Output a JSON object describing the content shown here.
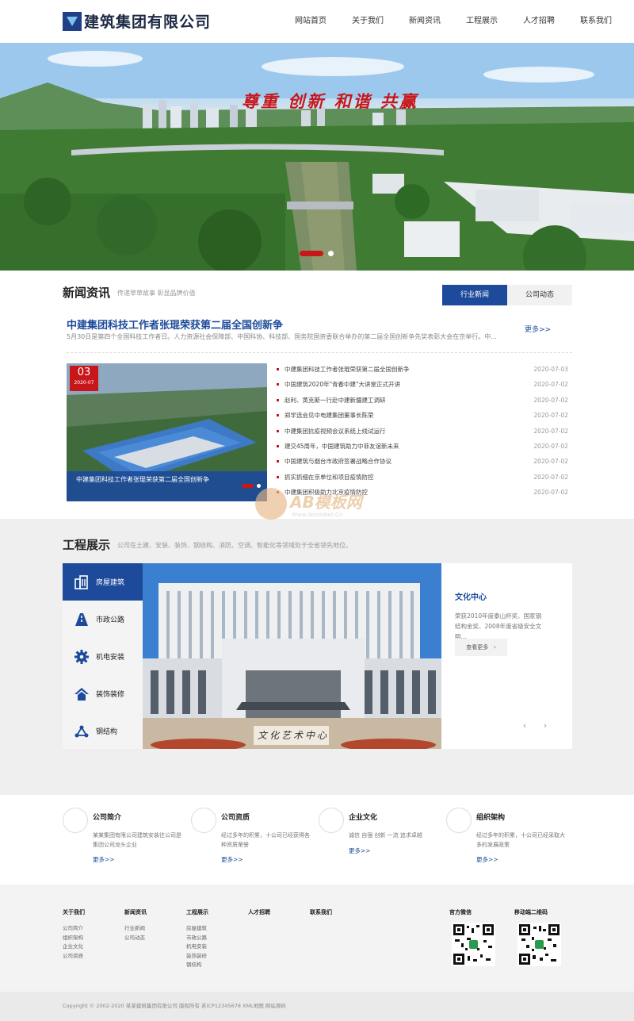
{
  "header": {
    "logo_text": "建筑集团有限公司",
    "nav": [
      "网站首页",
      "关于我们",
      "新闻资讯",
      "工程展示",
      "人才招聘",
      "联系我们"
    ]
  },
  "banner": {
    "slogan": "尊重 创新 和谐 共赢",
    "slide_index": 1,
    "slide_count": 2
  },
  "news": {
    "title": "新闻资讯",
    "subtitle": "传递草草故事 彰显品牌价值",
    "tabs": [
      "行业新闻",
      "公司动态"
    ],
    "active_tab": "行业新闻",
    "headline": "中建集团科技工作者张琨荣获第二届全国创新争",
    "headline_desc": "5月30日是第四个全国科技工作者日。人力资源社会保障部、中国科协、科技部、国务院国资委联合举办的第二届全国创新争先奖表彰大会在京举行。中...",
    "more": "更多>>",
    "featured": {
      "day": "03",
      "ym": "2020-07",
      "caption": "中建集团科技工作者张琨荣获第二届全国创新争"
    },
    "items": [
      {
        "title": "中建集团科技工作者张琨荣获第二届全国创新争",
        "date": "2020-07-03"
      },
      {
        "title": "中国建筑2020年\"青春中建\"大讲堂正式开讲",
        "date": "2020-07-02"
      },
      {
        "title": "赵利、黄克斯一行赴中建新疆建工调研",
        "date": "2020-07-02"
      },
      {
        "title": "郑学选会见中电建集团董事长陈荣",
        "date": "2020-07-02"
      },
      {
        "title": "中建集团抗疫视频会议系统上线试运行",
        "date": "2020-07-02"
      },
      {
        "title": "建交45周年，中国建筑助力中菲友谊新未来",
        "date": "2020-07-02"
      },
      {
        "title": "中国建筑与烟台市政府签署战略合作协议",
        "date": "2020-07-02"
      },
      {
        "title": "抓实抓细在京单位和项目疫情防控",
        "date": "2020-07-02"
      },
      {
        "title": "中建集团积极助力北京疫情防控",
        "date": "2020-07-02"
      }
    ]
  },
  "watermark": {
    "text": "AB模板网",
    "sub": "Www.AbmbNet.Cn"
  },
  "projects": {
    "title": "工程展示",
    "subtitle": "公司在土建、安装、装饰、钢结构、消防、空调、智能化等领域处于全省领先地位。",
    "categories": [
      {
        "label": "房屋建筑",
        "icon": "building-icon"
      },
      {
        "label": "市政公路",
        "icon": "road-icon"
      },
      {
        "label": "机电安装",
        "icon": "gear-icon"
      },
      {
        "label": "装饰装修",
        "icon": "house-icon"
      },
      {
        "label": "钢结构",
        "icon": "structure-icon"
      }
    ],
    "active_category": "房屋建筑",
    "photo_sign": "文化艺术中心",
    "project_title": "文化中心",
    "project_desc": "荣获2010年度泰山杯奖、国家钢结构金奖、2008年度省级安全文明...",
    "more_btn": "查看更多",
    "more_btn_arrow": "›",
    "prev": "‹",
    "next": "›"
  },
  "about": [
    {
      "title": "公司简介",
      "desc": "某某集团有限公司建筑安装往公司是集团公司龙头企业",
      "more": "更多>>"
    },
    {
      "title": "公司资质",
      "desc": "经过多年的积累，十公司已经获得各种资质荣誉",
      "more": "更多>>"
    },
    {
      "title": "企业文化",
      "desc": "诚信 自强 创新 一流 追求卓越",
      "more": "更多>>"
    },
    {
      "title": "组织架构",
      "desc": "经过多年的积累，十公司已经采取大多的发展政策",
      "more": "更多>>"
    }
  ],
  "footer": {
    "columns": [
      {
        "title": "关于我们",
        "links": [
          "公司简介",
          "组织架构",
          "企业文化",
          "公司资质"
        ]
      },
      {
        "title": "新闻资讯",
        "links": [
          "行业新闻",
          "公司动态"
        ]
      },
      {
        "title": "工程展示",
        "links": [
          "房屋建筑",
          "市政公路",
          "机电安装",
          "装饰装修",
          "钢结构"
        ]
      },
      {
        "title": "人才招聘",
        "links": []
      },
      {
        "title": "联系我们",
        "links": []
      }
    ],
    "qr_titles": [
      "官方微信",
      "移动端二维码"
    ],
    "copyright": "Copyright © 2002-2020 某某建筑集团有限公司 版权所有 苏ICP12345678 XML地图 网站源码"
  },
  "colors": {
    "primary": "#1d4a9a",
    "accent": "#c8171b",
    "light_bg": "#efefef"
  }
}
